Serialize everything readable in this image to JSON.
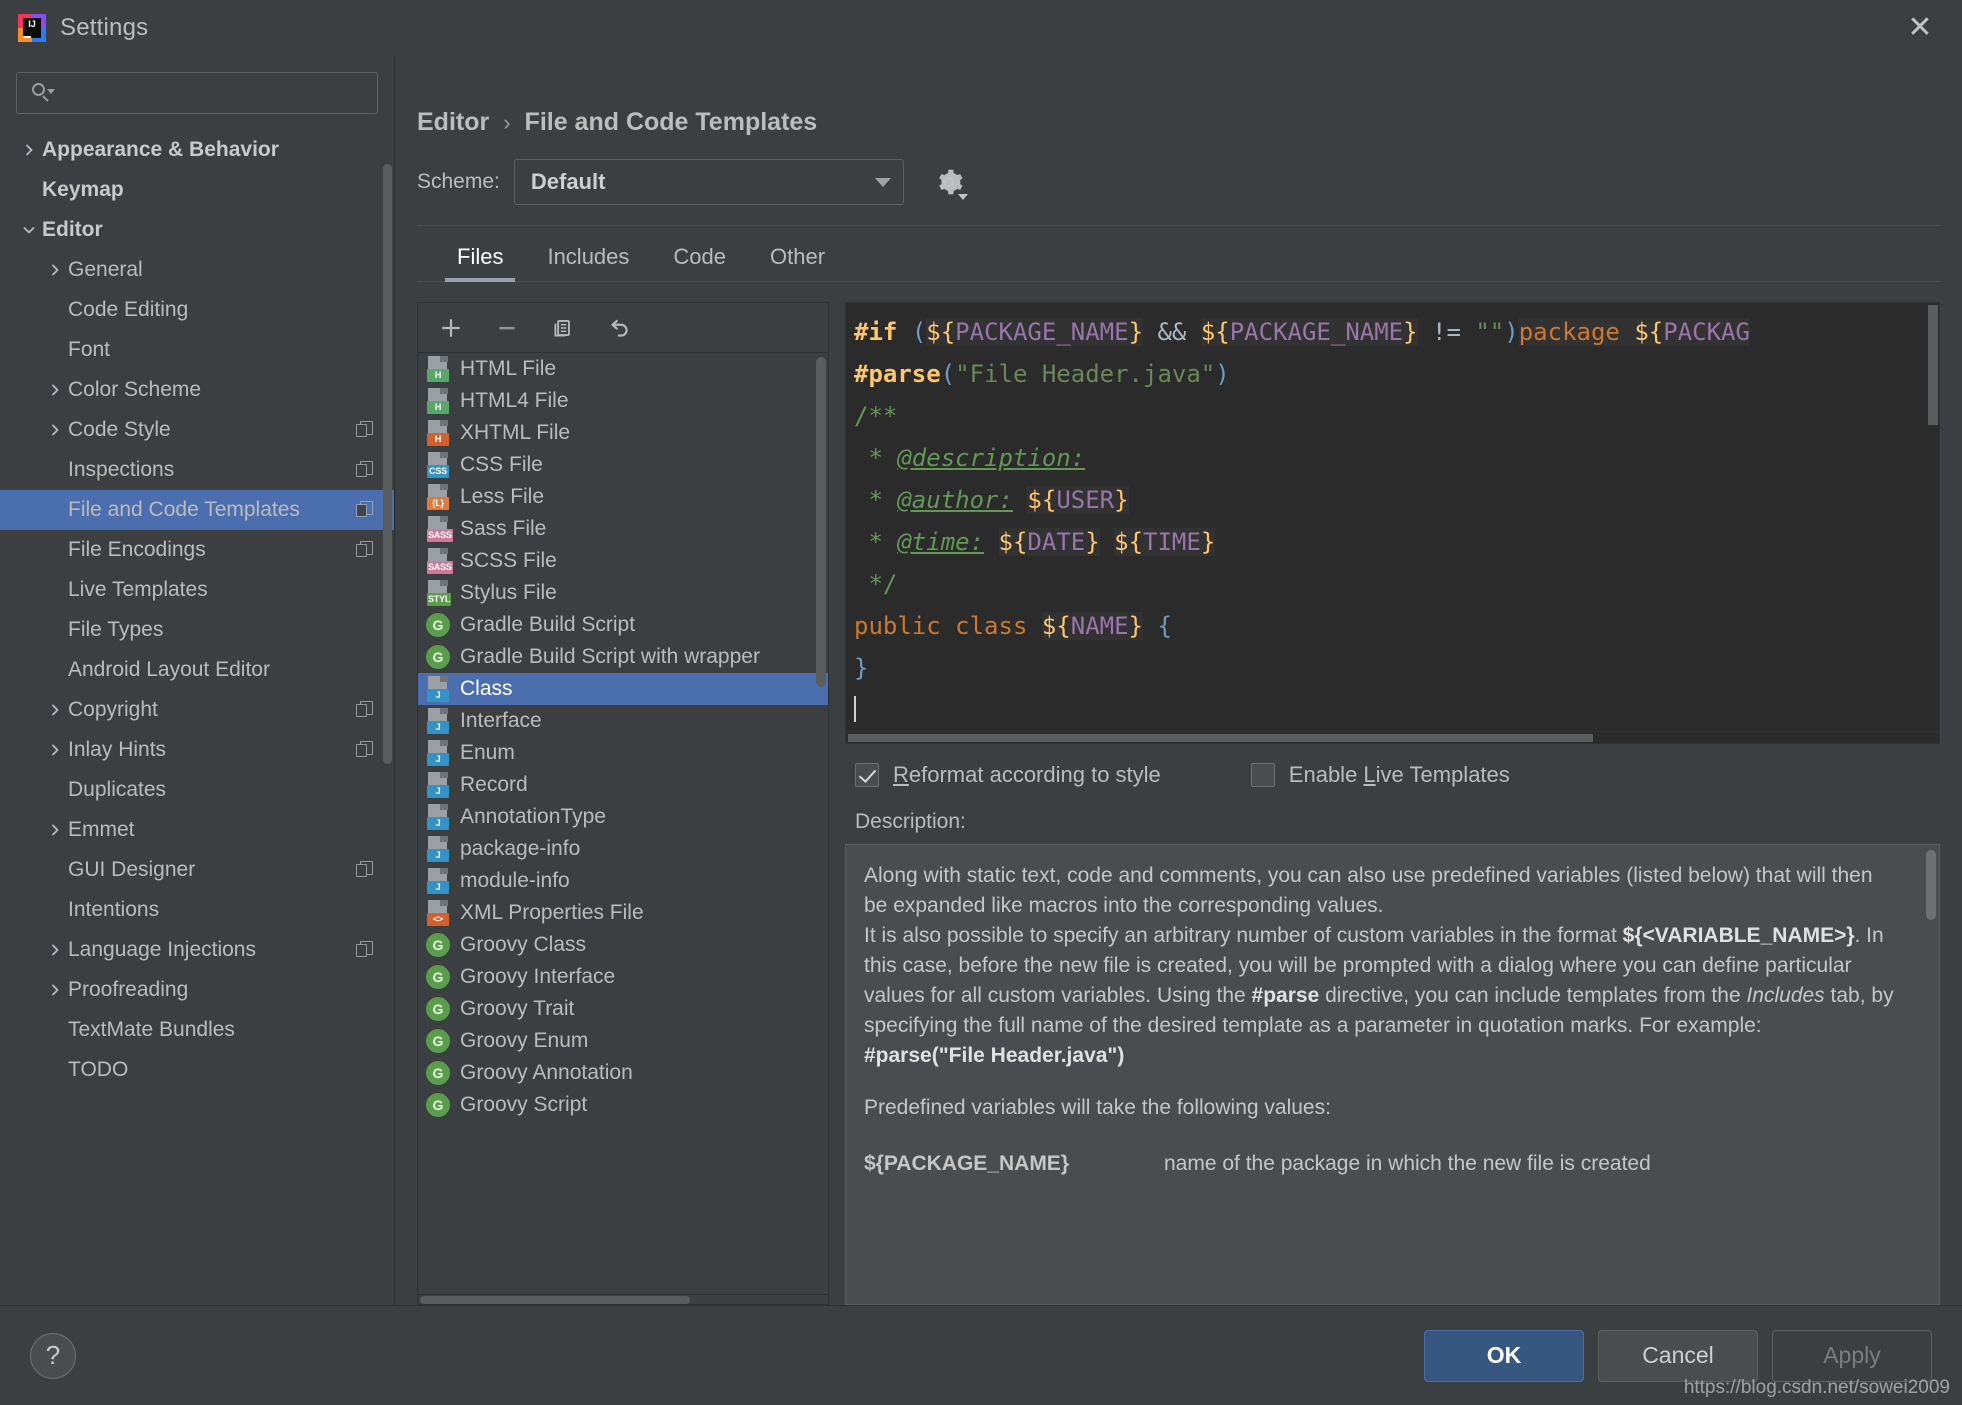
{
  "window": {
    "title": "Settings",
    "logo_letters": "IJ",
    "close_icon": "close-icon"
  },
  "search": {
    "value": "",
    "placeholder": ""
  },
  "sidebar": {
    "items": [
      {
        "label": "Appearance & Behavior",
        "level": 0,
        "arrow": "right",
        "bold": true,
        "badge": false,
        "selected": false
      },
      {
        "label": "Keymap",
        "level": 0,
        "arrow": "none",
        "bold": true,
        "badge": false,
        "selected": false
      },
      {
        "label": "Editor",
        "level": 0,
        "arrow": "down",
        "bold": true,
        "badge": false,
        "selected": false
      },
      {
        "label": "General",
        "level": 1,
        "arrow": "right",
        "bold": false,
        "badge": false,
        "selected": false
      },
      {
        "label": "Code Editing",
        "level": 1,
        "arrow": "none",
        "bold": false,
        "badge": false,
        "selected": false
      },
      {
        "label": "Font",
        "level": 1,
        "arrow": "none",
        "bold": false,
        "badge": false,
        "selected": false
      },
      {
        "label": "Color Scheme",
        "level": 1,
        "arrow": "right",
        "bold": false,
        "badge": false,
        "selected": false
      },
      {
        "label": "Code Style",
        "level": 1,
        "arrow": "right",
        "bold": false,
        "badge": true,
        "selected": false
      },
      {
        "label": "Inspections",
        "level": 1,
        "arrow": "none",
        "bold": false,
        "badge": true,
        "selected": false
      },
      {
        "label": "File and Code Templates",
        "level": 1,
        "arrow": "none",
        "bold": false,
        "badge": true,
        "selected": true
      },
      {
        "label": "File Encodings",
        "level": 1,
        "arrow": "none",
        "bold": false,
        "badge": true,
        "selected": false
      },
      {
        "label": "Live Templates",
        "level": 1,
        "arrow": "none",
        "bold": false,
        "badge": false,
        "selected": false
      },
      {
        "label": "File Types",
        "level": 1,
        "arrow": "none",
        "bold": false,
        "badge": false,
        "selected": false
      },
      {
        "label": "Android Layout Editor",
        "level": 1,
        "arrow": "none",
        "bold": false,
        "badge": false,
        "selected": false
      },
      {
        "label": "Copyright",
        "level": 1,
        "arrow": "right",
        "bold": false,
        "badge": true,
        "selected": false
      },
      {
        "label": "Inlay Hints",
        "level": 1,
        "arrow": "right",
        "bold": false,
        "badge": true,
        "selected": false
      },
      {
        "label": "Duplicates",
        "level": 1,
        "arrow": "none",
        "bold": false,
        "badge": false,
        "selected": false
      },
      {
        "label": "Emmet",
        "level": 1,
        "arrow": "right",
        "bold": false,
        "badge": false,
        "selected": false
      },
      {
        "label": "GUI Designer",
        "level": 1,
        "arrow": "none",
        "bold": false,
        "badge": true,
        "selected": false
      },
      {
        "label": "Intentions",
        "level": 1,
        "arrow": "none",
        "bold": false,
        "badge": false,
        "selected": false
      },
      {
        "label": "Language Injections",
        "level": 1,
        "arrow": "right",
        "bold": false,
        "badge": true,
        "selected": false
      },
      {
        "label": "Proofreading",
        "level": 1,
        "arrow": "right",
        "bold": false,
        "badge": false,
        "selected": false
      },
      {
        "label": "TextMate Bundles",
        "level": 1,
        "arrow": "none",
        "bold": false,
        "badge": false,
        "selected": false
      },
      {
        "label": "TODO",
        "level": 1,
        "arrow": "none",
        "bold": false,
        "badge": false,
        "selected": false
      }
    ]
  },
  "breadcrumb": {
    "parent": "Editor",
    "separator": "›",
    "current": "File and Code Templates"
  },
  "scheme": {
    "label": "Scheme:",
    "value": "Default",
    "gear_icon": "gear-icon"
  },
  "tabs": [
    {
      "label": "Files",
      "active": true
    },
    {
      "label": "Includes",
      "active": false
    },
    {
      "label": "Code",
      "active": false
    },
    {
      "label": "Other",
      "active": false
    }
  ],
  "list_toolbar": [
    {
      "name": "add-template-button",
      "icon": "plus-icon"
    },
    {
      "name": "remove-template-button",
      "icon": "minus-icon"
    },
    {
      "name": "copy-template-button",
      "icon": "copy-icon"
    },
    {
      "name": "reset-template-button",
      "icon": "undo-icon"
    }
  ],
  "templates": [
    {
      "name": "HTML File",
      "icon": "file-icon",
      "tag": "H",
      "tag_color": "#59a869",
      "selected": false
    },
    {
      "name": "HTML4 File",
      "icon": "file-icon",
      "tag": "H",
      "tag_color": "#59a869",
      "selected": false
    },
    {
      "name": "XHTML File",
      "icon": "file-icon",
      "tag": "H",
      "tag_color": "#d1622e",
      "selected": false
    },
    {
      "name": "CSS File",
      "icon": "file-icon",
      "tag": "CSS",
      "tag_color": "#3592c4",
      "selected": false
    },
    {
      "name": "Less File",
      "icon": "file-icon",
      "tag": "{L}",
      "tag_color": "#e07a3a",
      "selected": false
    },
    {
      "name": "Sass File",
      "icon": "file-icon",
      "tag": "SASS",
      "tag_color": "#d07896",
      "selected": false
    },
    {
      "name": "SCSS File",
      "icon": "file-icon",
      "tag": "SASS",
      "tag_color": "#d07896",
      "selected": false
    },
    {
      "name": "Stylus File",
      "icon": "file-icon",
      "tag": "STYL",
      "tag_color": "#5a9e4b",
      "selected": false
    },
    {
      "name": "Gradle Build Script",
      "icon": "groovy-icon",
      "tag": "G",
      "tag_color": "#5a9e4b",
      "selected": false
    },
    {
      "name": "Gradle Build Script with wrapper",
      "icon": "groovy-icon",
      "tag": "G",
      "tag_color": "#5a9e4b",
      "selected": false
    },
    {
      "name": "Class",
      "icon": "file-icon",
      "tag": "J",
      "tag_color": "#3592c4",
      "selected": true
    },
    {
      "name": "Interface",
      "icon": "file-icon",
      "tag": "J",
      "tag_color": "#3592c4",
      "selected": false
    },
    {
      "name": "Enum",
      "icon": "file-icon",
      "tag": "J",
      "tag_color": "#3592c4",
      "selected": false
    },
    {
      "name": "Record",
      "icon": "file-icon",
      "tag": "J",
      "tag_color": "#3592c4",
      "selected": false
    },
    {
      "name": "AnnotationType",
      "icon": "file-icon",
      "tag": "J",
      "tag_color": "#3592c4",
      "selected": false
    },
    {
      "name": "package-info",
      "icon": "file-icon",
      "tag": "J",
      "tag_color": "#3592c4",
      "selected": false
    },
    {
      "name": "module-info",
      "icon": "file-icon",
      "tag": "J",
      "tag_color": "#3592c4",
      "selected": false
    },
    {
      "name": "XML Properties File",
      "icon": "file-icon",
      "tag": "<>",
      "tag_color": "#d1622e",
      "selected": false
    },
    {
      "name": "Groovy Class",
      "icon": "groovy-icon",
      "tag": "G",
      "tag_color": "#5a9e4b",
      "selected": false
    },
    {
      "name": "Groovy Interface",
      "icon": "groovy-icon",
      "tag": "G",
      "tag_color": "#5a9e4b",
      "selected": false
    },
    {
      "name": "Groovy Trait",
      "icon": "groovy-icon",
      "tag": "G",
      "tag_color": "#5a9e4b",
      "selected": false
    },
    {
      "name": "Groovy Enum",
      "icon": "groovy-icon",
      "tag": "G",
      "tag_color": "#5a9e4b",
      "selected": false
    },
    {
      "name": "Groovy Annotation",
      "icon": "groovy-icon",
      "tag": "G",
      "tag_color": "#5a9e4b",
      "selected": false
    },
    {
      "name": "Groovy Script",
      "icon": "groovy-icon",
      "tag": "G",
      "tag_color": "#5a9e4b",
      "selected": false
    }
  ],
  "code": {
    "lines": [
      "#if (${PACKAGE_NAME} && ${PACKAGE_NAME} != \"\")package ${PACKAG",
      "#parse(\"File Header.java\")",
      "/**",
      " * @description: ",
      " * @author: ${USER}",
      " * @time: ${DATE} ${TIME}",
      " */",
      "public class ${NAME} {",
      "}",
      ""
    ]
  },
  "options": {
    "reformat": {
      "label": "Reformat according to style",
      "checked": true
    },
    "live_templates": {
      "label": "Enable Live Templates",
      "checked": false
    }
  },
  "description": {
    "label": "Description:",
    "p1": "Along with static text, code and comments, you can also use predefined variables (listed below) that will then be expanded like macros into the corresponding values.",
    "p2_a": "It is also possible to specify an arbitrary number of custom variables in the format ",
    "p2_b": "${<VARIABLE_NAME>}",
    "p2_c": ". In this case, before the new file is created, you will be prompted with a dialog where you can define particular values for all custom variables.",
    "p3_a": "Using the ",
    "p3_b": "#parse",
    "p3_c": " directive, you can include templates from the ",
    "p3_d": "Includes",
    "p3_e": " tab, by specifying the full name of the desired template as a parameter in quotation marks. For example:",
    "p4": "#parse(\"File Header.java\")",
    "p5": "Predefined variables will take the following values:",
    "var_name": "${PACKAGE_NAME}",
    "var_desc": "name of the package in which the new file is created"
  },
  "footer": {
    "help_icon": "question-mark-icon",
    "ok": "OK",
    "cancel": "Cancel",
    "apply": "Apply",
    "watermark": "https://blog.csdn.net/sowei2009"
  }
}
